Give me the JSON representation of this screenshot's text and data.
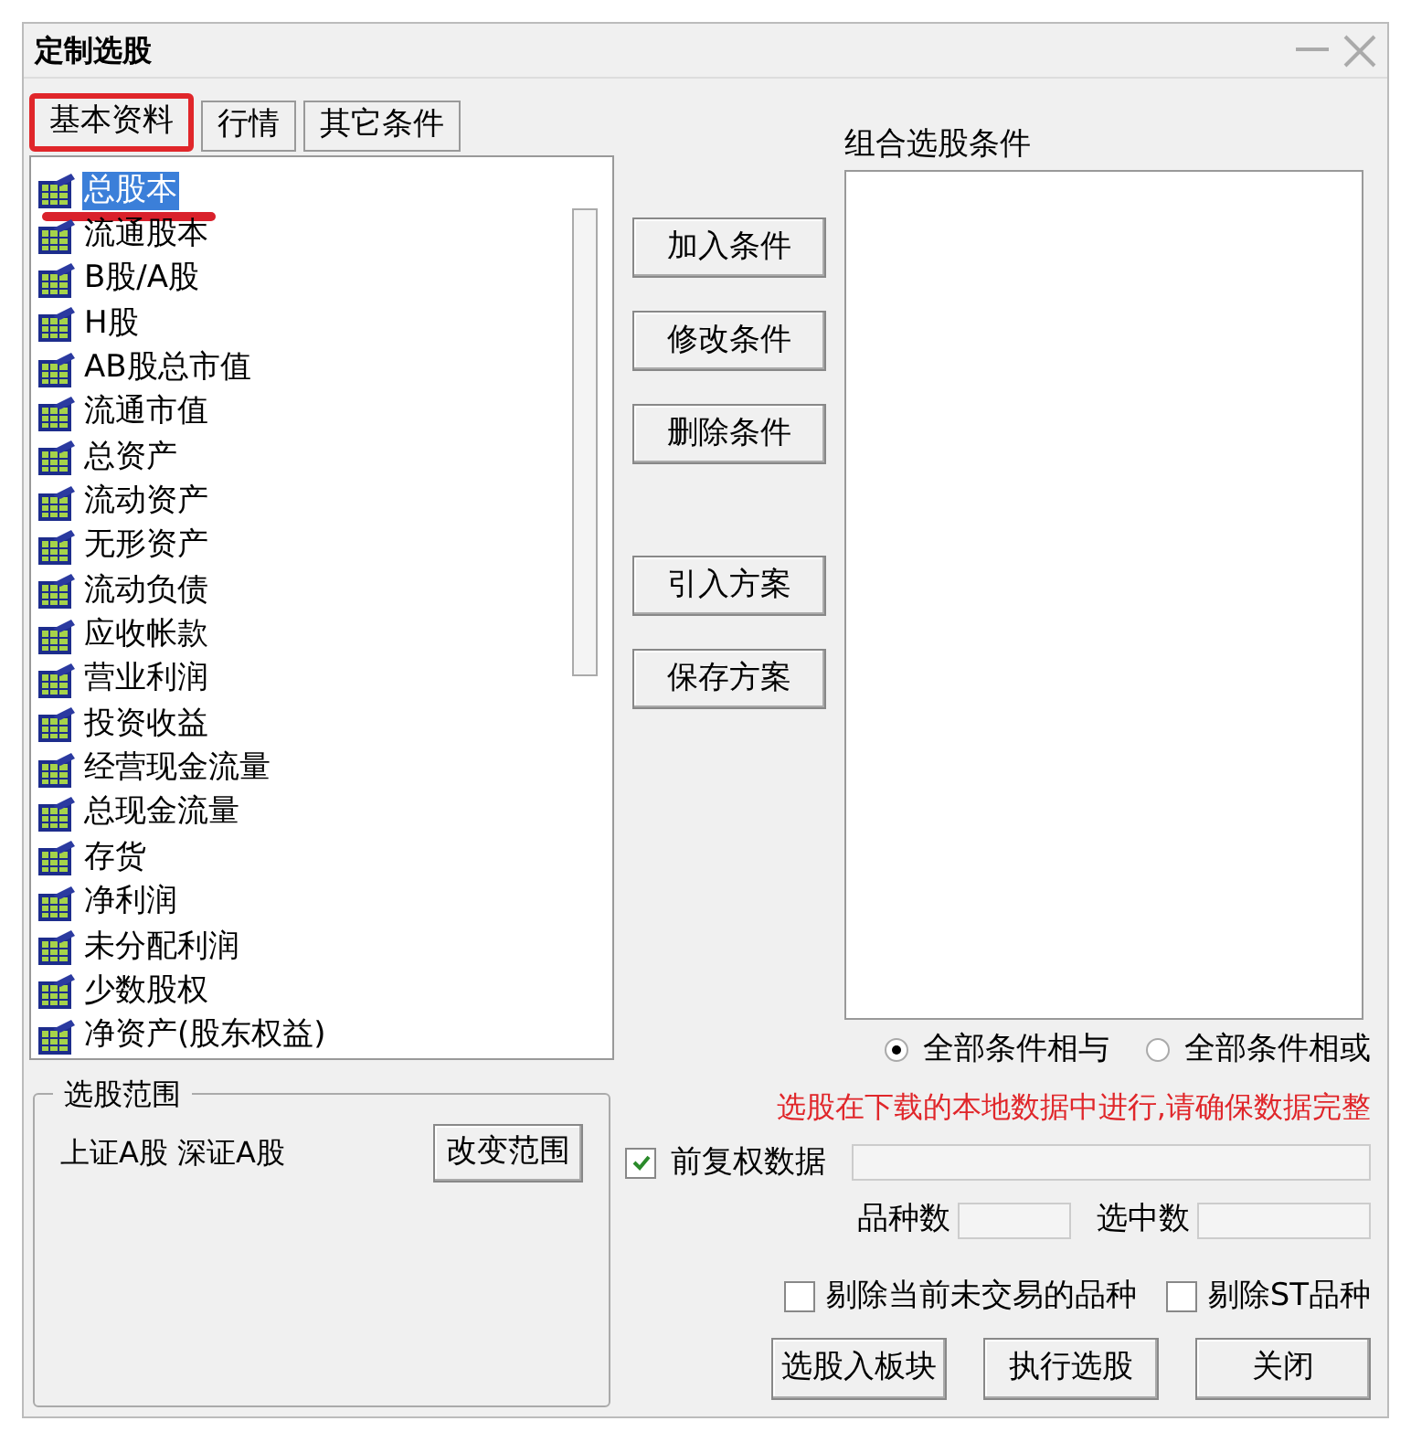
{
  "window": {
    "title": "定制选股"
  },
  "tabs": [
    {
      "label": "基本资料",
      "selected": true
    },
    {
      "label": "行情",
      "selected": false
    },
    {
      "label": "其它条件",
      "selected": false
    }
  ],
  "items": [
    {
      "label": "总股本",
      "selected": true
    },
    {
      "label": "流通股本",
      "selected": false
    },
    {
      "label": "B股/A股",
      "selected": false
    },
    {
      "label": "H股",
      "selected": false
    },
    {
      "label": "AB股总市值",
      "selected": false
    },
    {
      "label": "流通市值",
      "selected": false
    },
    {
      "label": "总资产",
      "selected": false
    },
    {
      "label": "流动资产",
      "selected": false
    },
    {
      "label": "无形资产",
      "selected": false
    },
    {
      "label": "流动负债",
      "selected": false
    },
    {
      "label": "应收帐款",
      "selected": false
    },
    {
      "label": "营业利润",
      "selected": false
    },
    {
      "label": "投资收益",
      "selected": false
    },
    {
      "label": "经营现金流量",
      "selected": false
    },
    {
      "label": "总现金流量",
      "selected": false
    },
    {
      "label": "存货",
      "selected": false
    },
    {
      "label": "净利润",
      "selected": false
    },
    {
      "label": "未分配利润",
      "selected": false
    },
    {
      "label": "少数股权",
      "selected": false
    },
    {
      "label": "净资产(股东权益)",
      "selected": false
    }
  ],
  "action_buttons": [
    {
      "label": "加入条件"
    },
    {
      "label": "修改条件"
    },
    {
      "label": "删除条件"
    },
    {
      "label": "引入方案"
    },
    {
      "label": "保存方案"
    }
  ],
  "conditions": {
    "title": "组合选股条件"
  },
  "logic": [
    {
      "label": "全部条件相与",
      "selected": true
    },
    {
      "label": "全部条件相或",
      "selected": false
    }
  ],
  "notice": "选股在下载的本地数据中进行,请确保数据完整",
  "adjust": {
    "label": "前复权数据",
    "checked": true
  },
  "counts": [
    {
      "label": "品种数"
    },
    {
      "label": "选中数"
    }
  ],
  "exclusions": [
    {
      "label": "剔除当前未交易的品种",
      "checked": false
    },
    {
      "label": "剔除ST品种",
      "checked": false
    }
  ],
  "scope": {
    "title": "选股范围",
    "text": "上证A股 深证A股",
    "button": "改变范围"
  },
  "bottom_buttons": [
    {
      "label": "选股入板块"
    },
    {
      "label": "执行选股"
    },
    {
      "label": "关闭"
    }
  ]
}
